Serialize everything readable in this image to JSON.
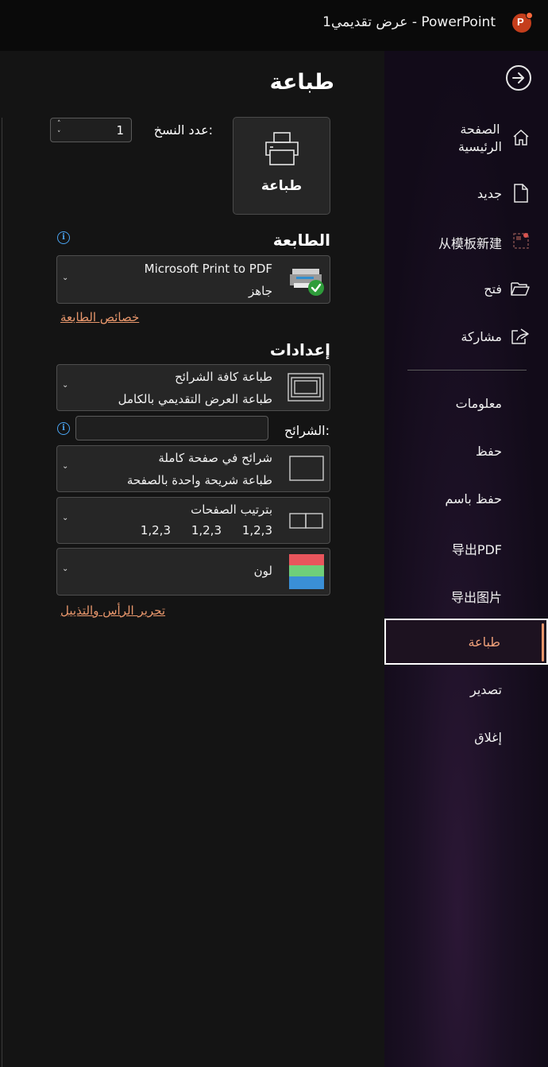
{
  "titlebar": {
    "title": "عرض تقديمي1  -  PowerPoint",
    "logo_letter": "P"
  },
  "sidebar": {
    "items_top": [
      {
        "label": "الصفحة\nالرئيسية",
        "icon": "home-icon"
      },
      {
        "label": "جديد",
        "icon": "new-document-icon"
      },
      {
        "label": "从模板新建",
        "icon": "template-icon"
      },
      {
        "label": "فتح",
        "icon": "open-folder-icon"
      },
      {
        "label": "مشاركة",
        "icon": "share-icon"
      }
    ],
    "items_bottom": [
      {
        "label": "معلومات"
      },
      {
        "label": "حفظ"
      },
      {
        "label": "حفظ باسم"
      },
      {
        "label": "导出PDF"
      },
      {
        "label": "导出图片"
      },
      {
        "label": "طباعة"
      },
      {
        "label": "تصدير"
      },
      {
        "label": "إغلاق"
      }
    ],
    "active": "طباعة"
  },
  "main": {
    "title": "طباعة",
    "print_button": "طباعة",
    "copies_label": "عدد النسخ:",
    "copies_value": "1",
    "printer_heading": "الطابعة",
    "printer": {
      "name": "Microsoft Print to PDF",
      "status": "جاهز"
    },
    "printer_properties_link": "خصائص الطابعة",
    "settings_heading": "إعدادات",
    "range": {
      "line1": "طباعة كافة الشرائح",
      "line2": "طباعة العرض التقديمي بالكامل"
    },
    "slides_label": "الشرائح:",
    "slides_value": "",
    "layout": {
      "line1": "شرائح في صفحة كاملة",
      "line2": "طباعة شريحة واحدة بالصفحة"
    },
    "collation": {
      "line1": "بترتيب الصفحات",
      "nums": [
        "1,2,3",
        "1,2,3",
        "1,2,3"
      ]
    },
    "color": {
      "line1": "لون"
    },
    "header_footer_link": "تحرير الرأس والتذييل"
  },
  "colors": {
    "accent": "#e8976c",
    "sidebar_bg": "#120b19",
    "main_bg": "#141414",
    "info_blue": "#4aa3f0",
    "check_green": "#2e9c3a"
  }
}
